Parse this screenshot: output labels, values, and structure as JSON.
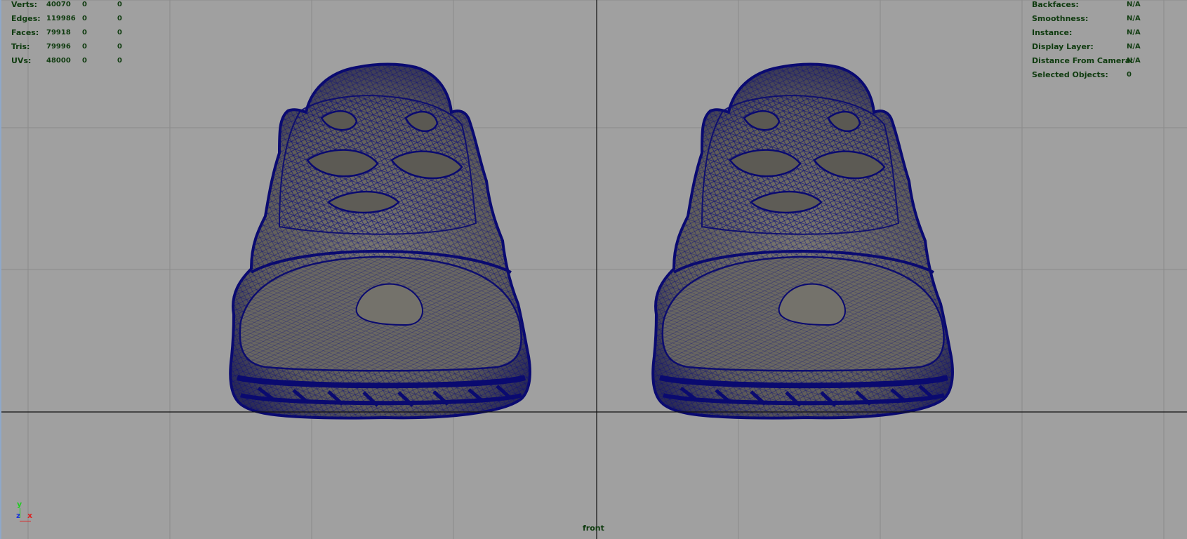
{
  "viewport": {
    "camera": "front",
    "background": "#a0a0a0",
    "grid_color": "#8a8a8a",
    "axis_line_color": "#111111",
    "wireframe_color": "#0c0c7a",
    "surface_color": "#6e6c66"
  },
  "poly_count": {
    "rows": [
      {
        "label": "Verts:",
        "total": "40070",
        "selected": "0",
        "component": "0"
      },
      {
        "label": "Edges:",
        "total": "119986",
        "selected": "0",
        "component": "0"
      },
      {
        "label": "Faces:",
        "total": "79918",
        "selected": "0",
        "component": "0"
      },
      {
        "label": "Tris:",
        "total": "79996",
        "selected": "0",
        "component": "0"
      },
      {
        "label": "UVs:",
        "total": "48000",
        "selected": "0",
        "component": "0"
      }
    ]
  },
  "object_details": {
    "rows": [
      {
        "label": "Backfaces:",
        "value": "N/A"
      },
      {
        "label": "Smoothness:",
        "value": "N/A"
      },
      {
        "label": "Instance:",
        "value": "N/A"
      },
      {
        "label": "Display Layer:",
        "value": "N/A"
      },
      {
        "label": "Distance From Camera:",
        "value": "N/A"
      },
      {
        "label": "Selected Objects:",
        "value": "0"
      }
    ]
  },
  "axis_gizmo": {
    "y_label": "y",
    "z_label": "z",
    "x_label": "x",
    "y_color": "#22cc22",
    "z_color": "#2233dd",
    "x_color": "#dd2222"
  },
  "models": [
    {
      "name": "shoe-model-left"
    },
    {
      "name": "shoe-model-right"
    }
  ]
}
